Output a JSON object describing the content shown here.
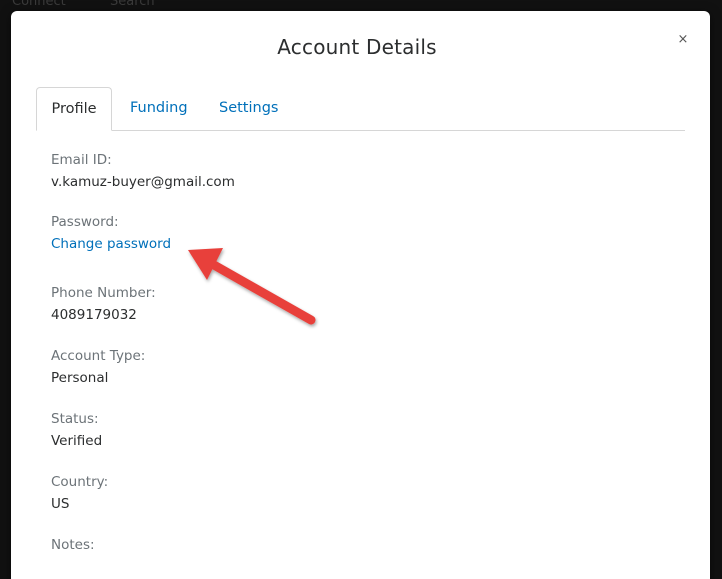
{
  "background": {
    "nav_items": [
      "Connect",
      "Search"
    ]
  },
  "modal": {
    "title": "Account Details",
    "close_label": "×",
    "tabs": [
      {
        "label": "Profile",
        "active": true
      },
      {
        "label": "Funding",
        "active": false
      },
      {
        "label": "Settings",
        "active": false
      }
    ],
    "fields": {
      "email": {
        "label": "Email ID:",
        "value": "v.kamuz-buyer@gmail.com"
      },
      "password": {
        "label": "Password:",
        "link": "Change password"
      },
      "phone": {
        "label": "Phone Number:",
        "value": "4089179032"
      },
      "account_type": {
        "label": "Account Type:",
        "value": "Personal"
      },
      "status": {
        "label": "Status:",
        "value": "Verified"
      },
      "country": {
        "label": "Country:",
        "value": "US"
      },
      "notes": {
        "label": "Notes:",
        "value": ""
      }
    }
  },
  "annotation": {
    "arrow_color": "#e8413b",
    "points_to": "Change password"
  },
  "colors": {
    "link": "#0070ba",
    "label": "#6c7378",
    "value": "#2c2e2f"
  }
}
